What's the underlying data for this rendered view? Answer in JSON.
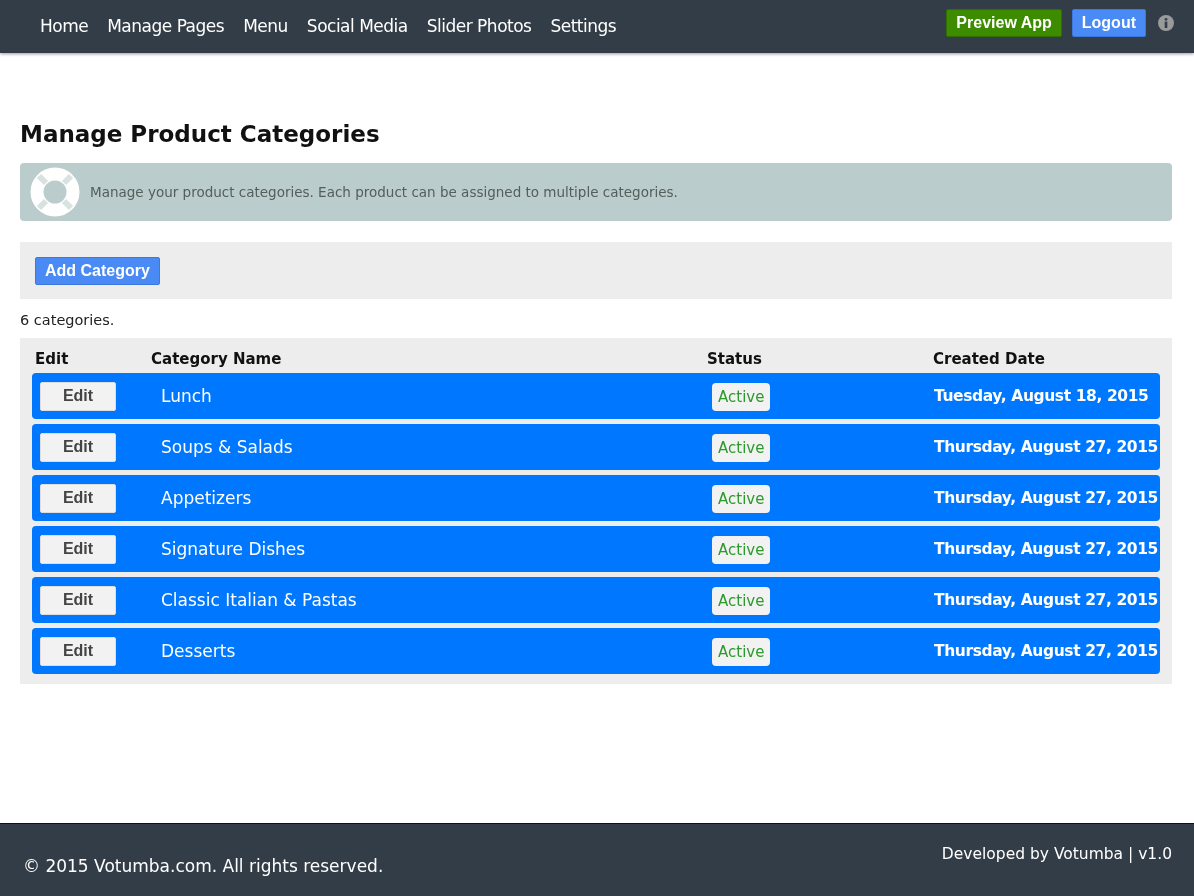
{
  "nav": {
    "items": [
      "Home",
      "Manage Pages",
      "Menu",
      "Social Media",
      "Slider Photos",
      "Settings"
    ],
    "preview_button": "Preview App",
    "logout_button": "Logout"
  },
  "page_title": "Manage Product Categories",
  "info_banner": "Manage your product categories. Each product can be assigned to multiple categories.",
  "add_button": "Add Category",
  "count": "6 categories.",
  "table": {
    "columns": [
      "Edit",
      "Category Name",
      "Status",
      "Created Date"
    ],
    "rows": [
      {
        "action": "Edit",
        "name": "Lunch",
        "status": "Active",
        "date": "Tuesday, August 18, 2015"
      },
      {
        "action": "Edit",
        "name": "Soups & Salads",
        "status": "Active",
        "date": "Thursday, August 27, 2015"
      },
      {
        "action": "Edit",
        "name": "Appetizers",
        "status": "Active",
        "date": "Thursday, August 27, 2015"
      },
      {
        "action": "Edit",
        "name": "Signature Dishes",
        "status": "Active",
        "date": "Thursday, August 27, 2015"
      },
      {
        "action": "Edit",
        "name": "Classic Italian & Pastas",
        "status": "Active",
        "date": "Thursday, August 27, 2015"
      },
      {
        "action": "Edit",
        "name": "Desserts",
        "status": "Active",
        "date": "Thursday, August 27, 2015"
      }
    ]
  },
  "footer": {
    "copyright": "© 2015 Votumba.com. All rights reserved.",
    "credit": "Developed by Votumba | v1.0"
  }
}
